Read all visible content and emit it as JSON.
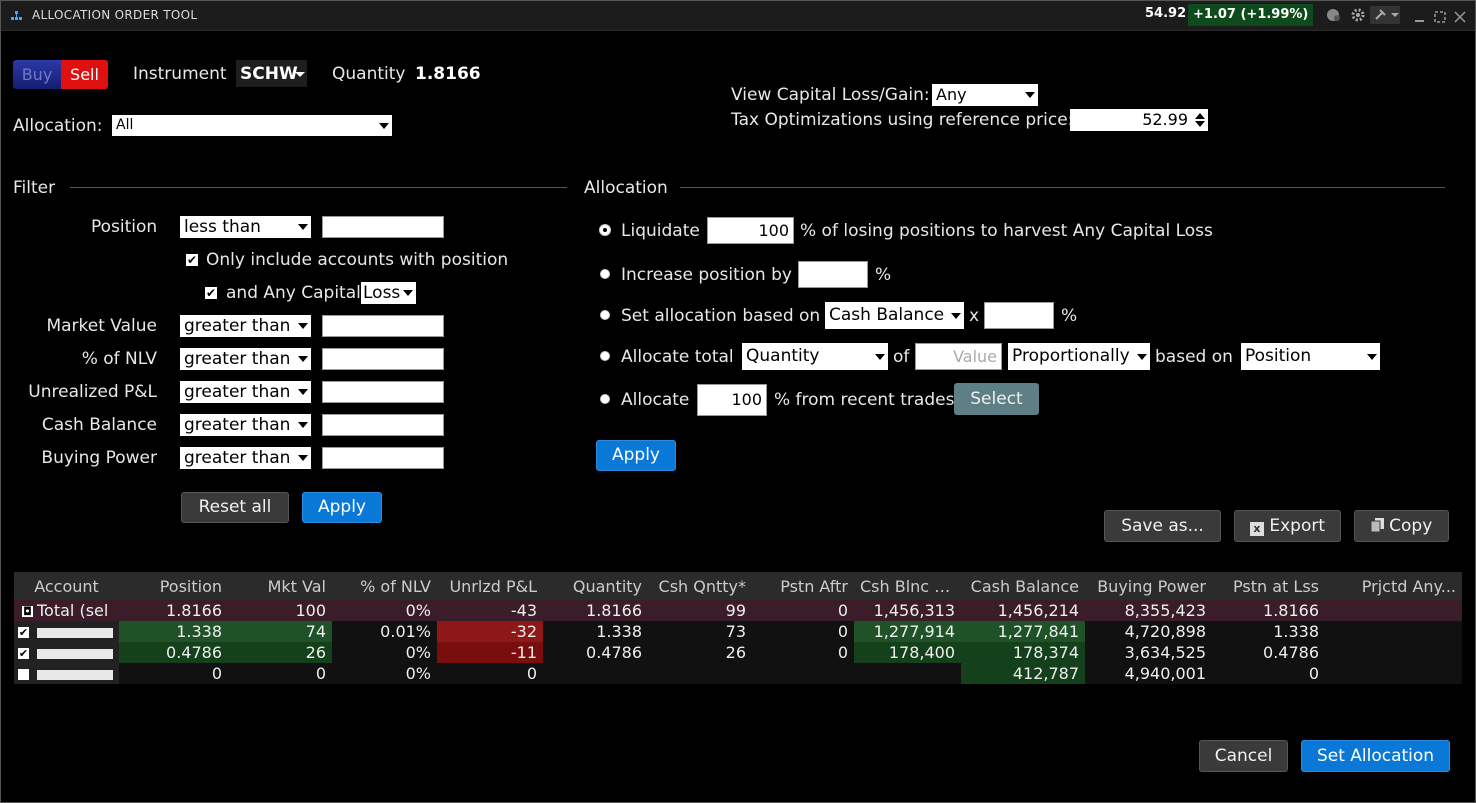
{
  "window": {
    "title": "ALLOCATION ORDER TOOL",
    "price": "54.92",
    "change": "+1.07 (+1.99%)"
  },
  "order": {
    "buy_label": "Buy",
    "sell_label": "Sell",
    "instrument_label": "Instrument",
    "instrument": "SCHW",
    "quantity_label": "Quantity",
    "quantity": "1.8166"
  },
  "allocation_select": {
    "label": "Allocation:",
    "value": "All"
  },
  "capital": {
    "view_label": "View Capital Loss/Gain:",
    "view_value": "Any",
    "tax_label": "Tax Optimizations using reference price:",
    "tax_value": "52.99"
  },
  "filter": {
    "title": "Filter",
    "position_label": "Position",
    "position_op": "less than",
    "only_include": "Only include accounts with position",
    "and_any_capital": "and Any Capital",
    "capital_type": "Loss",
    "rows": [
      {
        "label": "Market Value",
        "op": "greater than"
      },
      {
        "label": "% of NLV",
        "op": "greater than"
      },
      {
        "label": "Unrealized P&L",
        "op": "greater than"
      },
      {
        "label": "Cash Balance",
        "op": "greater than"
      },
      {
        "label": "Buying Power",
        "op": "greater than"
      }
    ],
    "reset_label": "Reset all",
    "apply_label": "Apply"
  },
  "alloc": {
    "title": "Allocation",
    "liquidate_label": "Liquidate",
    "liquidate_value": "100",
    "liquidate_suffix": "% of losing positions to harvest Any Capital Loss",
    "increase_label": "Increase position by",
    "increase_suffix": "%",
    "setalloc_label": "Set allocation based on",
    "setalloc_value": "Cash Balance",
    "x_label": "x",
    "pct": "%",
    "total_label": "Allocate total",
    "total_value": "Quantity",
    "of_label": "of",
    "value_placeholder": "Value",
    "proportion": "Proportionally",
    "based_on": "based on",
    "based_value": "Position",
    "recent_label": "Allocate",
    "recent_value": "100",
    "recent_suffix": "% from recent trades",
    "select_label": "Select",
    "apply_label": "Apply"
  },
  "actions": {
    "save_as": "Save as...",
    "export": "Export",
    "copy": "Copy",
    "cancel": "Cancel",
    "set_allocation": "Set Allocation"
  },
  "table": {
    "headers": [
      "Account",
      "Position",
      "Mkt Val",
      "% of NLV",
      "Unrlzd P&L",
      "Quantity",
      "Csh Qntty*",
      "Pstn Aftr",
      "Csh Blnc Aftr",
      "Cash Balance",
      "Buying Power",
      "Pstn at Lss",
      "Prjctd Any..."
    ],
    "total": [
      "Total (sel",
      "1.8166",
      "100",
      "0%",
      "-43",
      "1.8166",
      "99",
      "0",
      "1,456,313",
      "1,456,214",
      "8,355,423",
      "1.8166",
      ""
    ],
    "rows": [
      [
        "",
        "1.338",
        "74",
        "0.01%",
        "-32",
        "1.338",
        "73",
        "0",
        "1,277,914",
        "1,277,841",
        "4,720,898",
        "1.338",
        ""
      ],
      [
        "",
        "0.4786",
        "26",
        "0%",
        "-11",
        "0.4786",
        "26",
        "0",
        "178,400",
        "178,374",
        "3,634,525",
        "0.4786",
        ""
      ],
      [
        "",
        "0",
        "0",
        "0%",
        "0",
        "",
        "",
        "",
        "",
        "412,787",
        "4,940,001",
        "0",
        ""
      ]
    ]
  },
  "colors": {
    "blue": "#0a78d6",
    "sell_red": "#e01010",
    "buy_blue": "#1a2a8a",
    "green_cell": "#1f5226",
    "red_cell": "#8e1717",
    "header_total": "#3b1d2a"
  }
}
